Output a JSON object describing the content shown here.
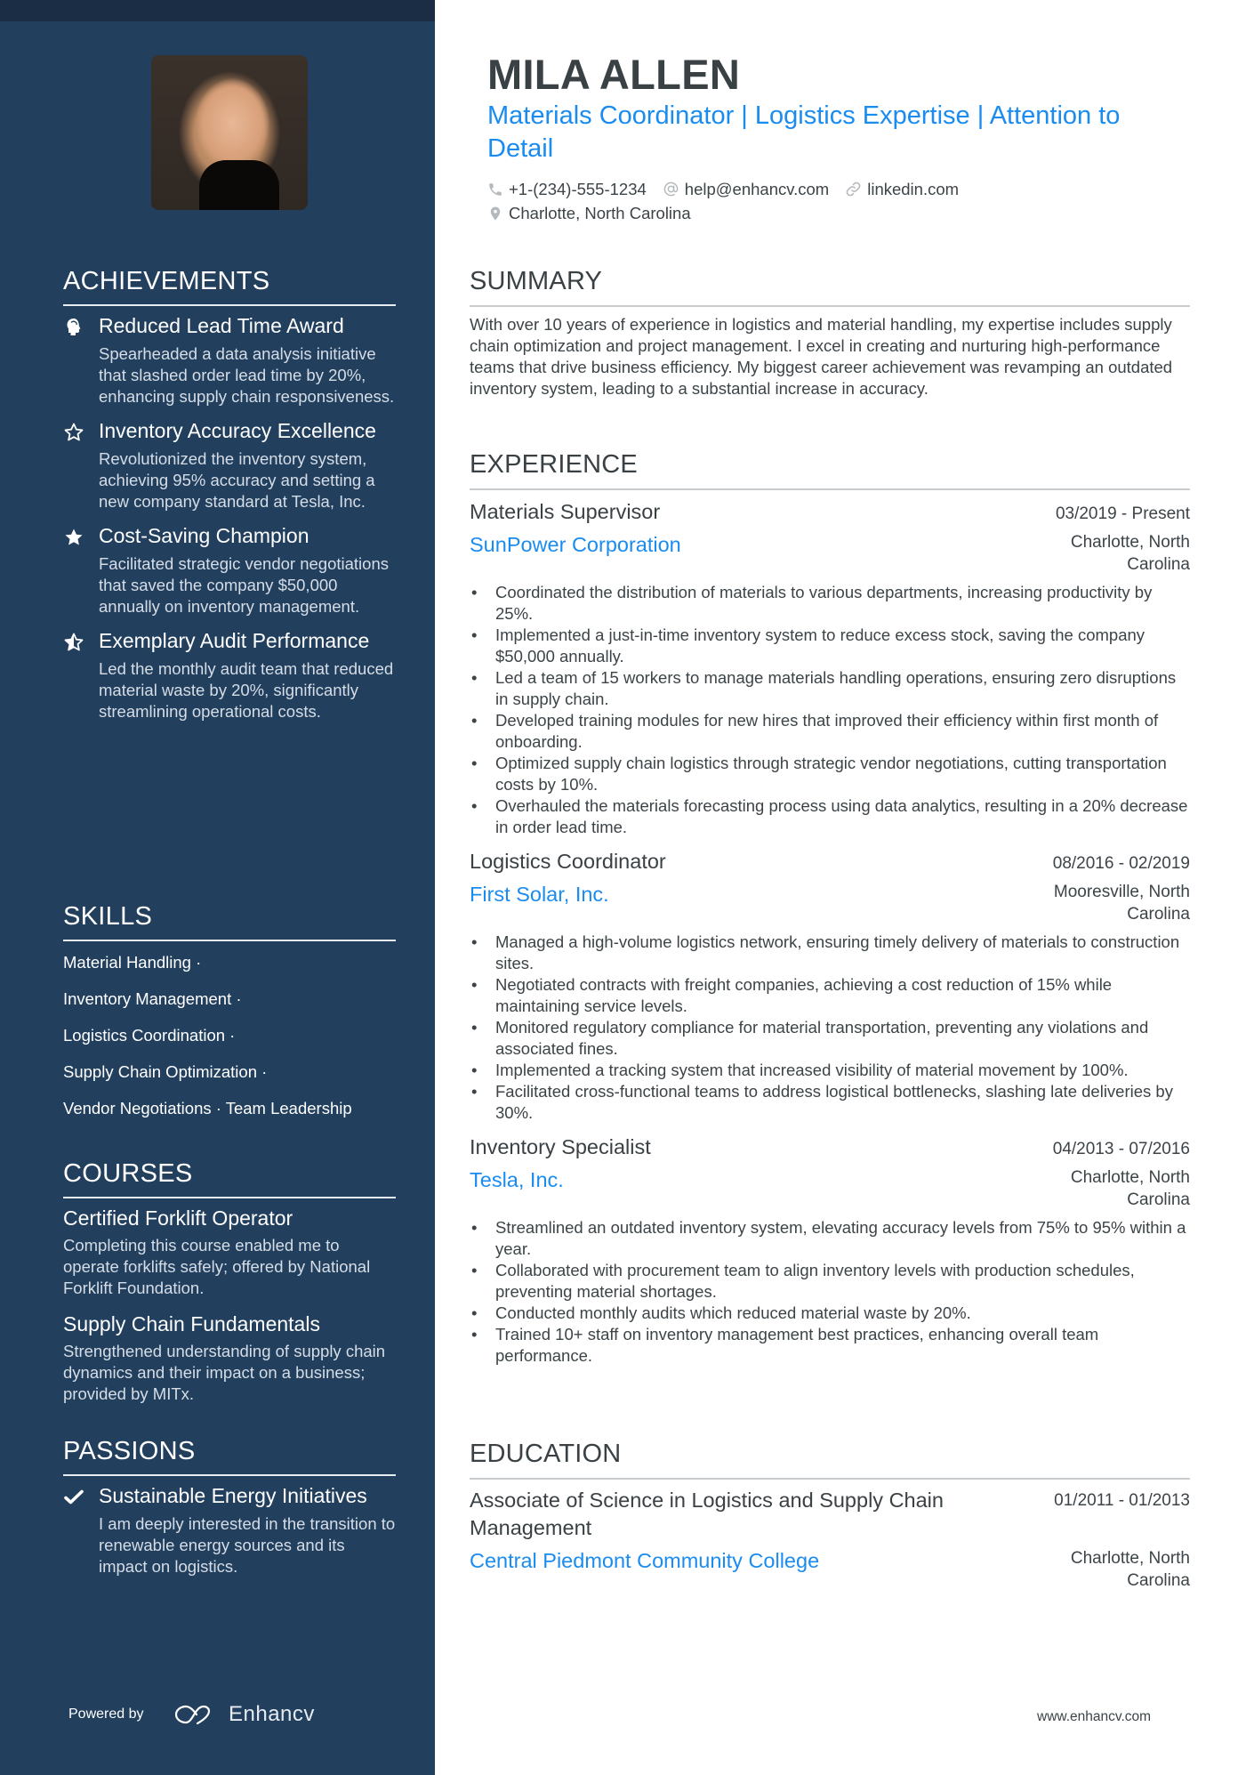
{
  "header": {
    "name": "MILA ALLEN",
    "title": "Materials Coordinator | Logistics Expertise | Attention to Detail",
    "contacts": {
      "phone": {
        "icon": "phone-icon",
        "value": "+1-(234)-555-1234"
      },
      "email": {
        "icon": "at-icon",
        "value": "help@enhancv.com"
      },
      "link": {
        "icon": "link-icon",
        "value": "linkedin.com"
      },
      "location": {
        "icon": "location-pin-icon",
        "value": "Charlotte, North Carolina"
      }
    }
  },
  "sidebar": {
    "achievements": {
      "heading": "ACHIEVEMENTS",
      "items": [
        {
          "icon": "brain-head-icon",
          "title": "Reduced Lead Time Award",
          "description": "Spearheaded a data analysis initiative that slashed order lead time by 20%, enhancing supply chain responsiveness."
        },
        {
          "icon": "star-outline-icon",
          "title": "Inventory Accuracy Excellence",
          "description": "Revolutionized the inventory system, achieving 95% accuracy and setting a new company standard at Tesla, Inc."
        },
        {
          "icon": "star-filled-icon",
          "title": "Cost-Saving Champion",
          "description": "Facilitated strategic vendor negotiations that saved the company $50,000 annually on inventory management."
        },
        {
          "icon": "star-half-icon",
          "title": "Exemplary Audit Performance",
          "description": "Led the monthly audit team that reduced material waste by 20%, significantly streamlining operational costs."
        }
      ]
    },
    "skills": {
      "heading": "SKILLS",
      "lines": [
        "Material Handling ·",
        "Inventory Management ·",
        "Logistics Coordination ·",
        "Supply Chain Optimization ·",
        "Vendor Negotiations · Team Leadership"
      ]
    },
    "courses": {
      "heading": "COURSES",
      "items": [
        {
          "title": "Certified Forklift Operator",
          "description": "Completing this course enabled me to operate forklifts safely; offered by National Forklift Foundation."
        },
        {
          "title": "Supply Chain Fundamentals",
          "description": "Strengthened understanding of supply chain dynamics and their impact on a business; provided by MITx."
        }
      ]
    },
    "passions": {
      "heading": "PASSIONS",
      "items": [
        {
          "icon": "checkmark-icon",
          "title": "Sustainable Energy Initiatives",
          "description": "I am deeply interested in the transition to renewable energy sources and its impact on logistics."
        }
      ]
    },
    "footer": {
      "powered_by": "Powered by",
      "brand": "Enhancv"
    }
  },
  "summary": {
    "heading": "SUMMARY",
    "text": "With over 10 years of experience in logistics and material handling, my expertise includes supply chain optimization and project management. I excel in creating and nurturing high-performance teams that drive business efficiency. My biggest career achievement was revamping an outdated inventory system, leading to a substantial increase in accuracy."
  },
  "experience": {
    "heading": "EXPERIENCE",
    "jobs": [
      {
        "title": "Materials Supervisor",
        "dates": "03/2019 - Present",
        "company": "SunPower Corporation",
        "location": "Charlotte, North Carolina",
        "bullets": [
          "Coordinated the distribution of materials to various departments, increasing productivity by 25%.",
          "Implemented a just-in-time inventory system to reduce excess stock, saving the company $50,000 annually.",
          "Led a team of 15 workers to manage materials handling operations, ensuring zero disruptions in supply chain.",
          "Developed training modules for new hires that improved their efficiency within first month of onboarding.",
          "Optimized supply chain logistics through strategic vendor negotiations, cutting transportation costs by 10%.",
          "Overhauled the materials forecasting process using data analytics, resulting in a 20% decrease in order lead time."
        ]
      },
      {
        "title": "Logistics Coordinator",
        "dates": "08/2016 - 02/2019",
        "company": "First Solar, Inc.",
        "location": "Mooresville, North Carolina",
        "bullets": [
          "Managed a high-volume logistics network, ensuring timely delivery of materials to construction sites.",
          "Negotiated contracts with freight companies, achieving a cost reduction of 15% while maintaining service levels.",
          "Monitored regulatory compliance for material transportation, preventing any violations and associated fines.",
          "Implemented a tracking system that increased visibility of material movement by 100%.",
          "Facilitated cross-functional teams to address logistical bottlenecks, slashing late deliveries by 30%."
        ]
      },
      {
        "title": "Inventory Specialist",
        "dates": "04/2013 - 07/2016",
        "company": "Tesla, Inc.",
        "location": "Charlotte, North Carolina",
        "bullets": [
          "Streamlined an outdated inventory system, elevating accuracy levels from 75% to 95% within a year.",
          "Collaborated with procurement team to align inventory levels with production schedules, preventing material shortages.",
          "Conducted monthly audits which reduced material waste by 20%.",
          "Trained 10+ staff on inventory management best practices, enhancing overall team performance."
        ]
      }
    ]
  },
  "education": {
    "heading": "EDUCATION",
    "items": [
      {
        "degree": "Associate of Science in Logistics and Supply Chain Management",
        "dates": "01/2011 - 01/2013",
        "school": "Central Piedmont Community College",
        "location": "Charlotte, North Carolina"
      }
    ]
  },
  "footer": {
    "url": "www.enhancv.com"
  },
  "colors": {
    "sidebar": "#223f5e",
    "sidebar_band": "#1b2d45",
    "accent": "#1a8cf0",
    "text": "#3c4448"
  }
}
